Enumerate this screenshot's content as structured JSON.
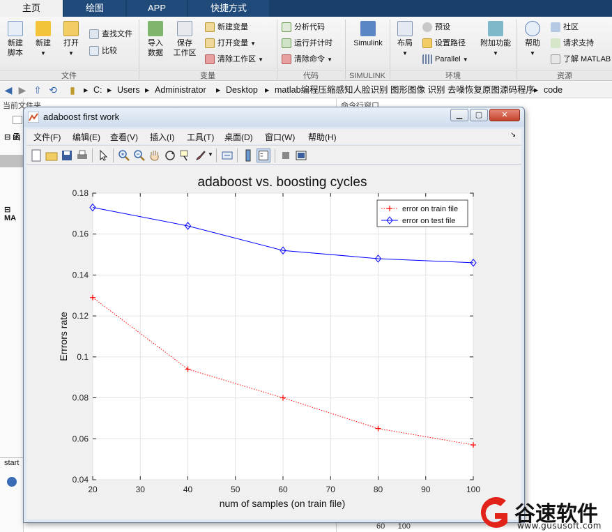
{
  "tabs": [
    "主页",
    "绘图",
    "APP",
    "快捷方式"
  ],
  "ribbon": {
    "file": {
      "new_script": "新建\n脚本",
      "new": "新建",
      "open": "打开",
      "find_files": "查找文件",
      "compare": "比较",
      "label": "文件"
    },
    "variable": {
      "import": "导入\n数据",
      "save_ws": "保存\n工作区",
      "new_var": "新建变量",
      "open_var": "打开变量",
      "clear_ws": "清除工作区",
      "label": "变量"
    },
    "code": {
      "analyze": "分析代码",
      "run_time": "运行并计时",
      "clear_cmd": "清除命令",
      "label": "代码"
    },
    "simulink": {
      "simulink": "Simulink",
      "label": "SIMULINK"
    },
    "env": {
      "layout": "布局",
      "prefs": "预设",
      "set_path": "设置路径",
      "parallel": "Parallel",
      "addons": "附加功能",
      "label": "环境"
    },
    "resources": {
      "help": "帮助",
      "community": "社区",
      "request_support": "请求支持",
      "learn": "了解 MATLAB",
      "label": "资源"
    }
  },
  "address": [
    "C:",
    "Users",
    "Administrator",
    "Desktop",
    "matlab编程压缩感知人脸识别 图形图像 识别 去噪恢复原图源码程序",
    "code"
  ],
  "side": {
    "current_folder": "当前文件夹",
    "command_window": "命令行窗口",
    "fn_label": "函",
    "ma_label": "MA",
    "start_label": "start"
  },
  "figure": {
    "title": "adaboost first work",
    "menus": [
      "文件(F)",
      "编辑(E)",
      "查看(V)",
      "插入(I)",
      "工具(T)",
      "桌面(D)",
      "窗口(W)",
      "帮助(H)"
    ]
  },
  "chart_data": {
    "type": "line",
    "title": "adaboost vs. boosting cycles",
    "xlabel": "num of samples (on train file)",
    "ylabel": "Errrors rate",
    "xlim": [
      20,
      100
    ],
    "ylim": [
      0.04,
      0.18
    ],
    "xticks": [
      20,
      30,
      40,
      50,
      60,
      70,
      80,
      90,
      100
    ],
    "yticks": [
      0.04,
      0.06,
      0.08,
      0.1,
      0.12,
      0.14,
      0.16,
      0.18
    ],
    "grid": true,
    "legend_position": "top-right",
    "x": [
      20,
      40,
      60,
      80,
      100
    ],
    "series": [
      {
        "name": "error on train file",
        "values": [
          0.129,
          0.094,
          0.08,
          0.065,
          0.057
        ],
        "color": "#ff0000",
        "marker": "+",
        "linestyle": "dotted"
      },
      {
        "name": "error on test file",
        "values": [
          0.173,
          0.164,
          0.152,
          0.148,
          0.146
        ],
        "color": "#0000ff",
        "marker": "diamond",
        "linestyle": "solid"
      }
    ]
  },
  "watermark": {
    "text": "谷速软件",
    "url": "www.gususoft.com"
  },
  "background_numbers": "60      100"
}
